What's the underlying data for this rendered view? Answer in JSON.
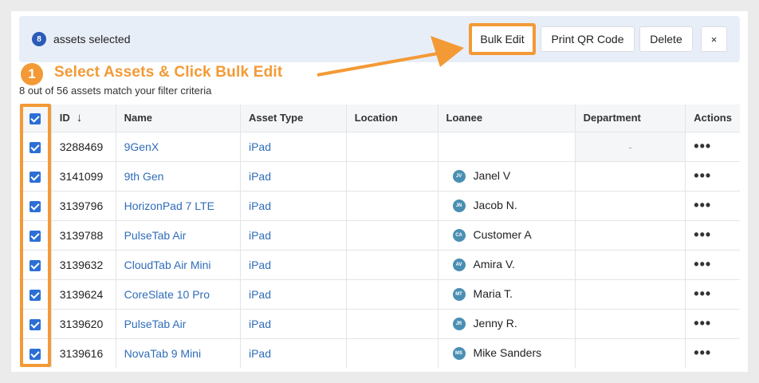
{
  "selection": {
    "count": "8",
    "label": "assets selected"
  },
  "toolbar": {
    "bulk_edit": "Bulk Edit",
    "print_qr": "Print QR Code",
    "delete": "Delete",
    "close": "×"
  },
  "annotation": {
    "step": "1",
    "text": "Select Assets & Click Bulk Edit"
  },
  "filter_summary": "8 out of 56 assets match your filter criteria",
  "table": {
    "headers": {
      "id": "ID",
      "sort": "↓",
      "name": "Name",
      "asset_type": "Asset Type",
      "location": "Location",
      "loanee": "Loanee",
      "department": "Department",
      "actions": "Actions"
    },
    "rows": [
      {
        "id": "3288469",
        "name": "9GenX",
        "type": "iPad",
        "location": "",
        "loanee_initials": "",
        "loanee": "",
        "department": "-"
      },
      {
        "id": "3141099",
        "name": "9th Gen",
        "type": "iPad",
        "location": "",
        "loanee_initials": "JV",
        "loanee": "Janel V",
        "department": ""
      },
      {
        "id": "3139796",
        "name": "HorizonPad 7 LTE",
        "type": "iPad",
        "location": "",
        "loanee_initials": "JN",
        "loanee": "Jacob N.",
        "department": ""
      },
      {
        "id": "3139788",
        "name": "PulseTab Air",
        "type": "iPad",
        "location": "",
        "loanee_initials": "CA",
        "loanee": "Customer A",
        "department": ""
      },
      {
        "id": "3139632",
        "name": "CloudTab Air Mini",
        "type": "iPad",
        "location": "",
        "loanee_initials": "AV",
        "loanee": "Amira V.",
        "department": ""
      },
      {
        "id": "3139624",
        "name": "CoreSlate 10 Pro",
        "type": "iPad",
        "location": "",
        "loanee_initials": "MT",
        "loanee": "Maria T.",
        "department": ""
      },
      {
        "id": "3139620",
        "name": "PulseTab Air",
        "type": "iPad",
        "location": "",
        "loanee_initials": "JR",
        "loanee": "Jenny R.",
        "department": ""
      },
      {
        "id": "3139616",
        "name": "NovaTab 9 Mini",
        "type": "iPad",
        "location": "",
        "loanee_initials": "MS",
        "loanee": "Mike Sanders",
        "department": ""
      }
    ],
    "actions_glyph": "•••"
  },
  "colors": {
    "accent": "#2b6fd6",
    "highlight": "#f39a36",
    "link": "#2f6db8"
  }
}
